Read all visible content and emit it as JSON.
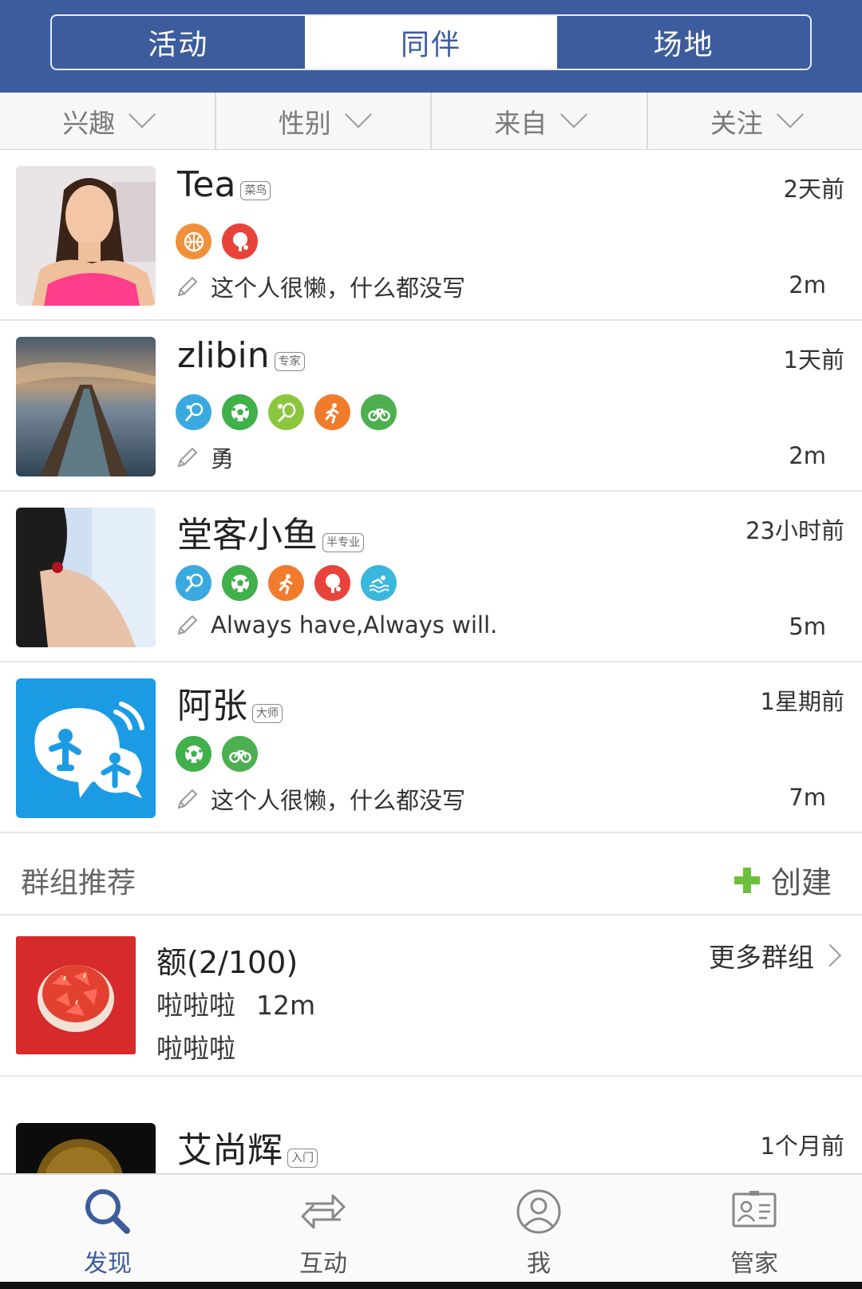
{
  "tabs": [
    {
      "label": "活动"
    },
    {
      "label": "同伴",
      "active": true
    },
    {
      "label": "场地"
    }
  ],
  "filters": [
    "兴趣",
    "性别",
    "来自",
    "关注"
  ],
  "users": [
    {
      "name": "Tea",
      "level": "菜鸟",
      "time": "2天前",
      "sports": [
        "basketball",
        "ping-pong"
      ],
      "signature": "这个人很懒，什么都没写",
      "distance": "2m"
    },
    {
      "name": "zlibin",
      "level": "专家",
      "time": "1天前",
      "sports": [
        "badminton",
        "soccer",
        "tennis",
        "running",
        "cycling"
      ],
      "signature": "勇",
      "distance": "2m"
    },
    {
      "name": "堂客小鱼",
      "level": "半专业",
      "time": "23小时前",
      "sports": [
        "badminton",
        "soccer",
        "running",
        "ping-pong",
        "swimming"
      ],
      "signature": "Always have,Always will.",
      "distance": "5m"
    },
    {
      "name": "阿张",
      "level": "大师",
      "time": "1星期前",
      "sports": [
        "soccer",
        "cycling"
      ],
      "signature": "这个人很懒，什么都没写",
      "distance": "7m"
    }
  ],
  "group_section": {
    "title": "群组推荐",
    "create_label": "创建"
  },
  "group": {
    "name": "额(2/100)",
    "desc": "啦啦啦",
    "distance": "12m",
    "line2": "啦啦啦",
    "more_label": "更多群组"
  },
  "partial_user": {
    "name": "艾尚辉",
    "level": "入门",
    "time": "1个月前"
  },
  "nav": [
    {
      "label": "发现",
      "icon": "search-icon",
      "active": true
    },
    {
      "label": "互动",
      "icon": "exchange-icon"
    },
    {
      "label": "我",
      "icon": "profile-icon"
    },
    {
      "label": "管家",
      "icon": "id-card-icon"
    }
  ],
  "colors": {
    "brand": "#3d5c9e",
    "create_plus": "#6bbf3b"
  }
}
